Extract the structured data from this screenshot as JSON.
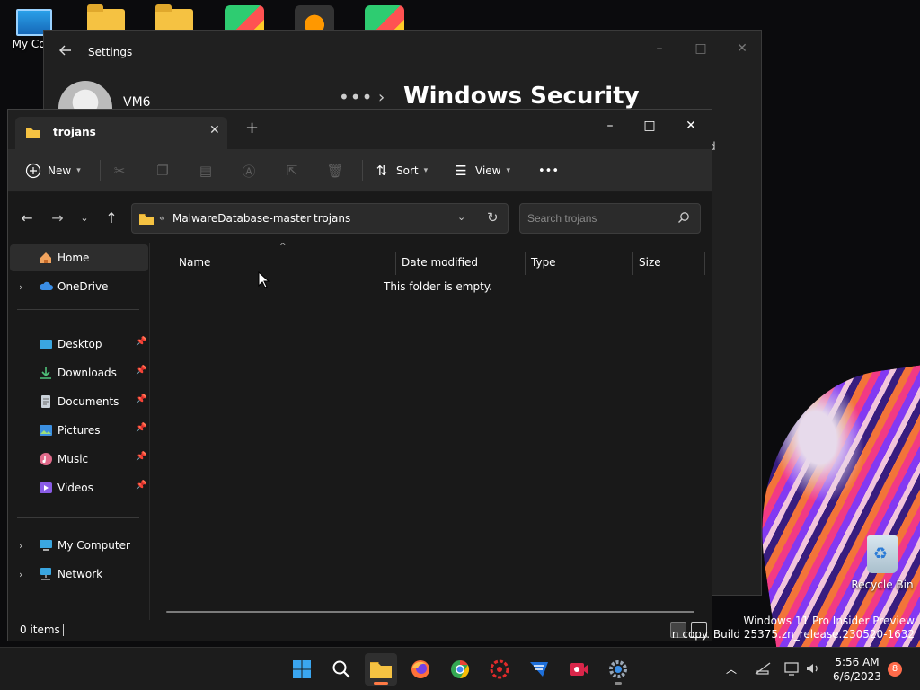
{
  "desktop": {
    "icons": [
      {
        "label": "My Com"
      }
    ],
    "recycle_bin_label": "Recycle Bin",
    "watermark_line1": "Windows 11 Pro Insider Preview",
    "watermark_line2": "n copy. Build 25375.zn_release.230520-1632"
  },
  "settings": {
    "title": "Settings",
    "username": "VM6",
    "breadcrumb_more": "•••",
    "breadcrumb_sep": "›",
    "page_title": "Windows Security",
    "stray_text": "d"
  },
  "explorer": {
    "tab_title": "trojans",
    "toolbar": {
      "new_label": "New",
      "sort_label": "Sort",
      "view_label": "View",
      "more_label": "•••"
    },
    "address": {
      "overflow": "«",
      "segment1": "MalwareDatabase-master",
      "sep": "›",
      "segment2": "trojans"
    },
    "search": {
      "placeholder": "Search trojans"
    },
    "nav": {
      "home": "Home",
      "onedrive": "OneDrive",
      "desktop": "Desktop",
      "downloads": "Downloads",
      "documents": "Documents",
      "pictures": "Pictures",
      "music": "Music",
      "videos": "Videos",
      "my_computer": "My Computer",
      "network": "Network"
    },
    "columns": {
      "name": "Name",
      "date_modified": "Date modified",
      "type": "Type",
      "size": "Size"
    },
    "empty_message": "This folder is empty.",
    "status": {
      "items": "0 items"
    }
  },
  "taskbar": {
    "time": "5:56 AM",
    "date": "6/6/2023",
    "notifications": "8"
  },
  "colors": {
    "accent": "#ff7a45",
    "folder": "#f5c242",
    "window_bg": "#191919"
  }
}
